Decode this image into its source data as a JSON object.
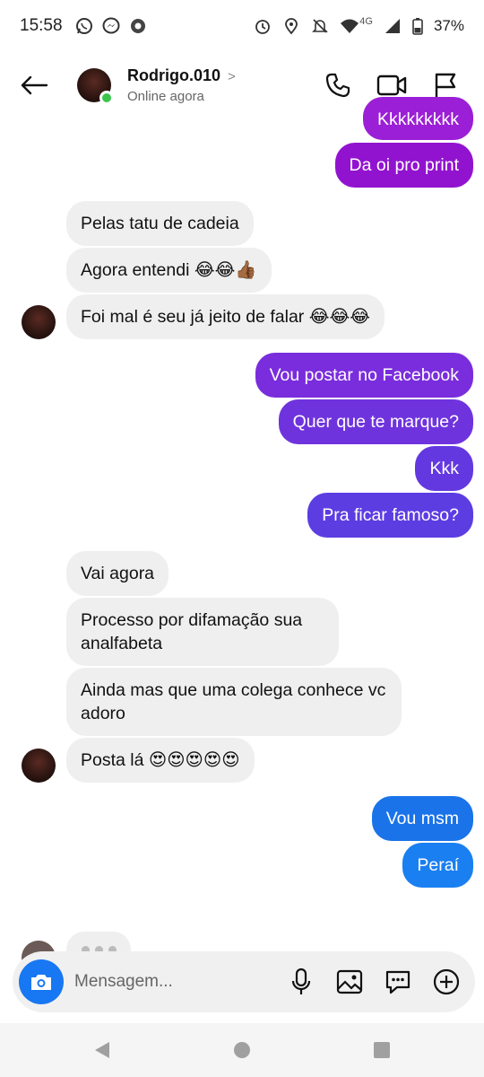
{
  "status_bar": {
    "time": "15:58",
    "network": "4G",
    "battery": "37%",
    "icons": [
      "whatsapp-icon",
      "messenger-icon",
      "app-icon",
      "alarm-icon",
      "location-icon",
      "mute-icon",
      "wifi-icon",
      "signal-icon",
      "battery-icon"
    ]
  },
  "header": {
    "contact_name": "Rodrigo.010",
    "chevron": ">",
    "status": "Online agora",
    "actions": [
      "phone-icon",
      "video-icon",
      "flag-icon"
    ]
  },
  "messages": [
    {
      "id": "m0",
      "side": "out",
      "text": "Kkkkkkkkk",
      "color": "#9b1fd6"
    },
    {
      "id": "m1",
      "side": "out",
      "text": "Da oi pro print",
      "color": "#9213cf"
    },
    {
      "id": "m2",
      "side": "in",
      "text": "Pelas tatu de cadeia"
    },
    {
      "id": "m3",
      "side": "in",
      "text": "Agora entendi 😂😂👍🏾"
    },
    {
      "id": "m4",
      "side": "in",
      "text": "Foi mal é seu já jeito de falar 😂😂😂"
    },
    {
      "id": "m5",
      "side": "out",
      "text": "Vou postar no Facebook",
      "color": "#7a2ddc"
    },
    {
      "id": "m6",
      "side": "out",
      "text": "Quer que te marque?",
      "color": "#6f33de"
    },
    {
      "id": "m7",
      "side": "out",
      "text": "Kkk",
      "color": "#6438e0"
    },
    {
      "id": "m8",
      "side": "out",
      "text": "Pra ficar famoso?",
      "color": "#5c3de2"
    },
    {
      "id": "m9",
      "side": "in",
      "text": "Vai agora"
    },
    {
      "id": "m10",
      "side": "in",
      "text": "Processo por difamação sua analfabeta"
    },
    {
      "id": "m11",
      "side": "in",
      "text": "Ainda mas que uma colega conhece vc adoro"
    },
    {
      "id": "m12",
      "side": "in",
      "text": "Posta lá 😍😍😍😍😍"
    },
    {
      "id": "m13",
      "side": "out",
      "text": "Vou msm",
      "color": "#1a73e8"
    },
    {
      "id": "m14",
      "side": "out",
      "text": "Peraí",
      "color": "#1a7ff0"
    }
  ],
  "composer": {
    "placeholder": "Mensagem...",
    "buttons": [
      "camera-icon",
      "microphone-icon",
      "gallery-icon",
      "sticker-icon",
      "plus-icon"
    ]
  },
  "navbar": [
    "back-triangle-icon",
    "home-circle-icon",
    "recents-square-icon"
  ],
  "colors": {
    "online": "#3bc44b",
    "incoming_bubble": "#efefef",
    "accent_blue": "#1877f2"
  }
}
